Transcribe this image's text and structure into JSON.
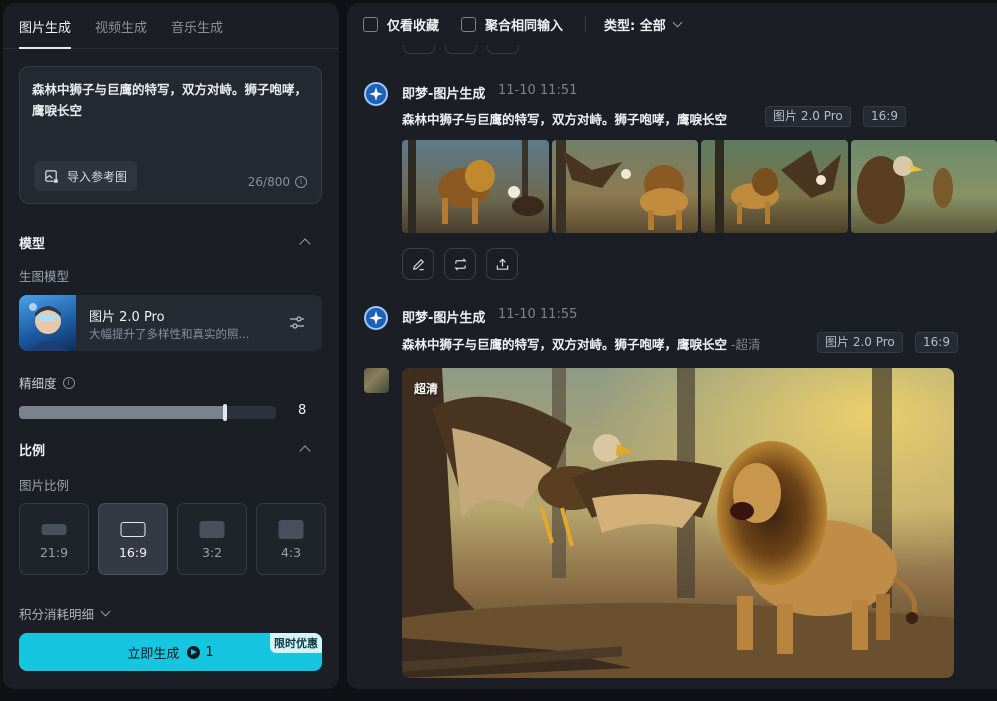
{
  "tabs": [
    {
      "label": "图片生成",
      "active": true
    },
    {
      "label": "视频生成",
      "active": false
    },
    {
      "label": "音乐生成",
      "active": false
    }
  ],
  "prompt": {
    "text": "森林中狮子与巨鹰的特写，双方对峙。狮子咆哮，鹰唳长空",
    "import_label": "导入参考图",
    "char_count": "26/800"
  },
  "model_section": {
    "title": "模型",
    "sub_label": "生图模型",
    "model_name": "图片 2.0 Pro",
    "model_desc": "大幅提升了多样性和真实的照..."
  },
  "detail": {
    "label": "精细度",
    "value": "8",
    "fraction": 0.8
  },
  "ratio_section": {
    "title": "比例",
    "sub_label": "图片比例",
    "options": [
      {
        "label": "21:9",
        "active": false
      },
      {
        "label": "16:9",
        "active": true
      },
      {
        "label": "3:2",
        "active": false
      },
      {
        "label": "4:3",
        "active": false
      }
    ]
  },
  "points_label": "积分消耗明细",
  "generate": {
    "label": "立即生成",
    "cost": "1",
    "badge": "限时优惠",
    "color": "#16c5df"
  },
  "topbar": {
    "fav_only": "仅看收藏",
    "merge_same": "聚合相同输入",
    "type_filter": "类型: 全部"
  },
  "entries": [
    {
      "name": "即梦-图片生成",
      "time": "11-10 11:51",
      "prompt": "森林中狮子与巨鹰的特写，双方对峙。狮子咆哮，鹰唳长空",
      "extra": "",
      "model_tag": "图片 2.0 Pro",
      "ratio_tag": "16:9"
    },
    {
      "name": "即梦-图片生成",
      "time": "11-10 11:55",
      "prompt": "森林中狮子与巨鹰的特写，双方对峙。狮子咆哮，鹰唳长空",
      "extra": "-超清",
      "model_tag": "图片 2.0 Pro",
      "ratio_tag": "16:9"
    }
  ],
  "hd_label": "超清"
}
